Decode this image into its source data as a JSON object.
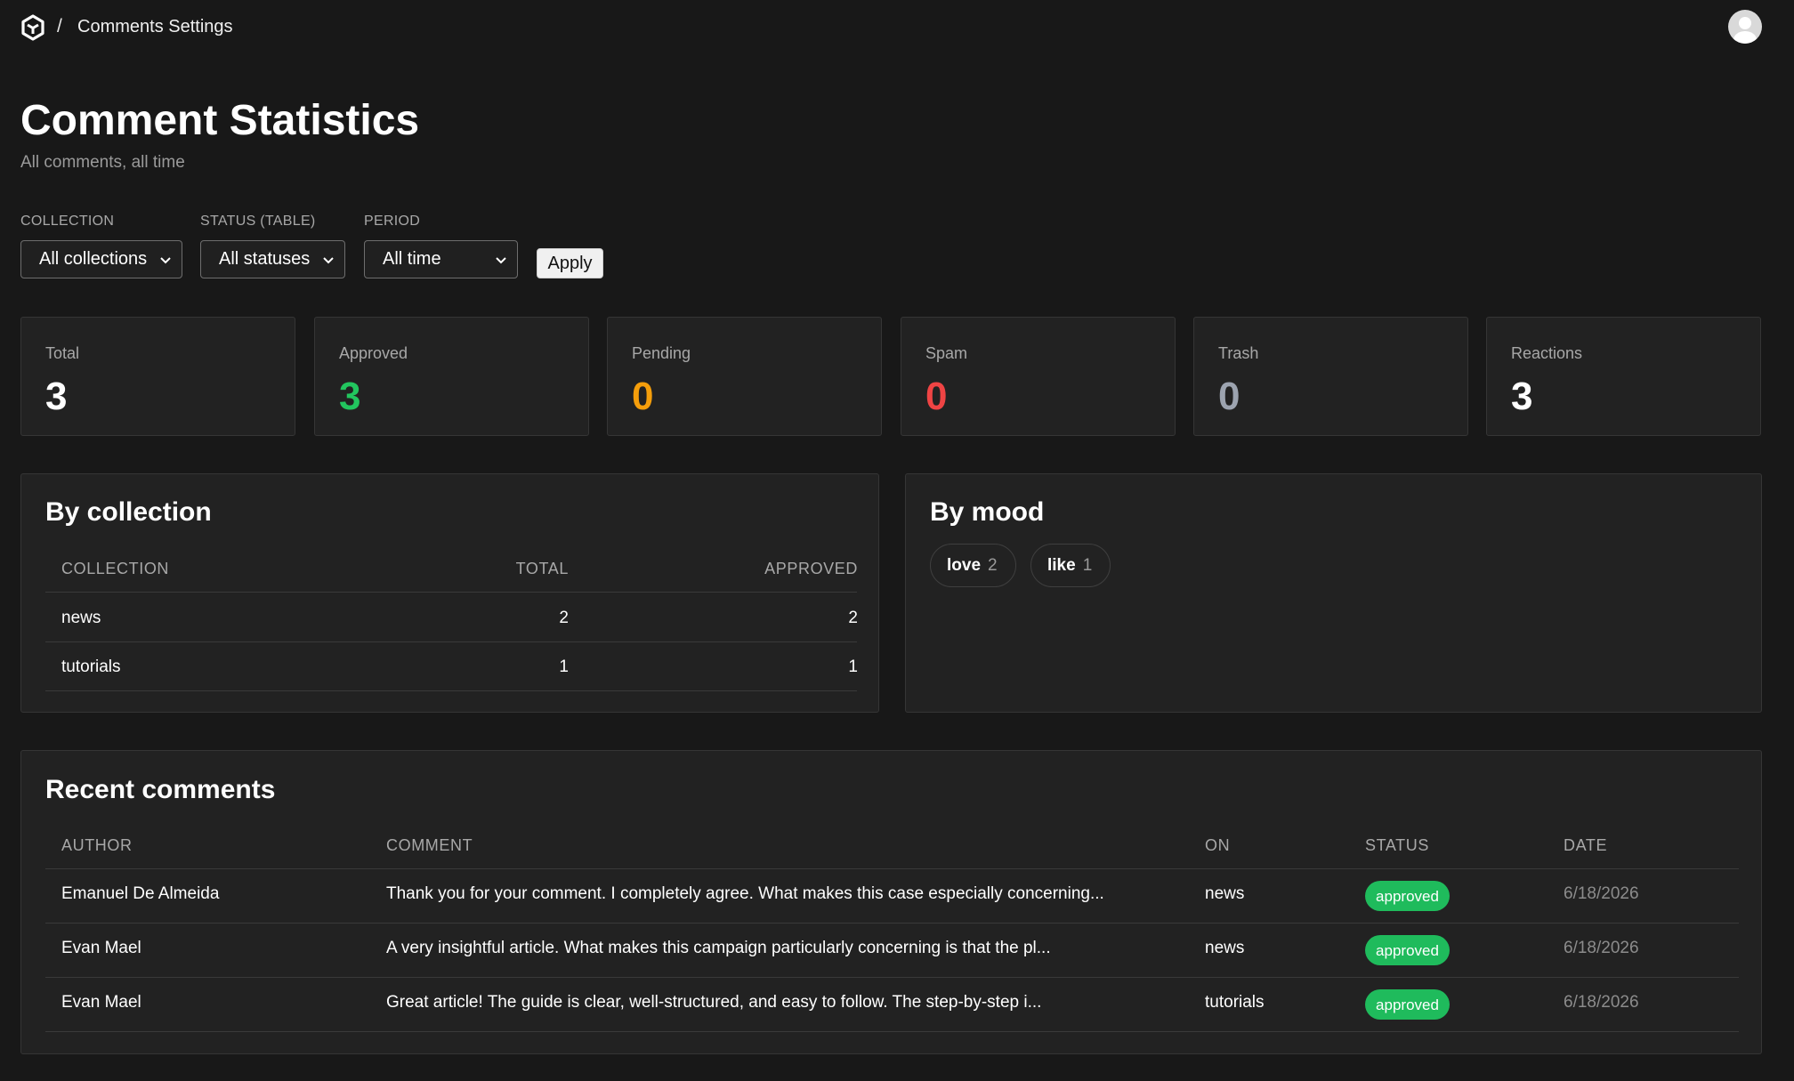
{
  "header": {
    "breadcrumb_separator": "/",
    "breadcrumb_label": "Comments Settings",
    "logo_icon": "hexagon-logo-icon",
    "avatar_icon": "user-avatar-icon"
  },
  "page": {
    "title": "Comment Statistics",
    "subtitle": "All comments, all time"
  },
  "filters": {
    "collection": {
      "label": "COLLECTION",
      "value": "All collections"
    },
    "status": {
      "label": "STATUS (TABLE)",
      "value": "All statuses"
    },
    "period": {
      "label": "PERIOD",
      "value": "All time"
    },
    "apply_label": "Apply"
  },
  "stats": [
    {
      "label": "Total",
      "value": "3",
      "color": "#ffffff"
    },
    {
      "label": "Approved",
      "value": "3",
      "color": "#22c55e"
    },
    {
      "label": "Pending",
      "value": "0",
      "color": "#f59e0b"
    },
    {
      "label": "Spam",
      "value": "0",
      "color": "#ef4444"
    },
    {
      "label": "Trash",
      "value": "0",
      "color": "#9ca3af"
    },
    {
      "label": "Reactions",
      "value": "3",
      "color": "#ffffff"
    }
  ],
  "by_collection": {
    "title": "By collection",
    "headers": [
      "COLLECTION",
      "TOTAL",
      "APPROVED"
    ],
    "rows": [
      {
        "collection": "news",
        "total": "2",
        "approved": "2"
      },
      {
        "collection": "tutorials",
        "total": "1",
        "approved": "1"
      }
    ]
  },
  "by_mood": {
    "title": "By mood",
    "chips": [
      {
        "name": "love",
        "count": "2"
      },
      {
        "name": "like",
        "count": "1"
      }
    ]
  },
  "recent": {
    "title": "Recent comments",
    "headers": [
      "AUTHOR",
      "COMMENT",
      "ON",
      "STATUS",
      "DATE"
    ],
    "rows": [
      {
        "author": "Emanuel De Almeida",
        "comment": "Thank you for your comment. I completely agree. What makes this case especially concerning...",
        "on": "news",
        "status": "approved",
        "date": "6/18/2026"
      },
      {
        "author": "Evan Mael",
        "comment": "A very insightful article. What makes this campaign particularly concerning is that the pl...",
        "on": "news",
        "status": "approved",
        "date": "6/18/2026"
      },
      {
        "author": "Evan Mael",
        "comment": "Great article! The guide is clear, well-structured, and easy to follow. The step-by-step i...",
        "on": "tutorials",
        "status": "approved",
        "date": "6/18/2026"
      }
    ]
  },
  "colors": {
    "background": "#181818",
    "card": "#222222",
    "approved_badge": "#1fbb5c"
  }
}
